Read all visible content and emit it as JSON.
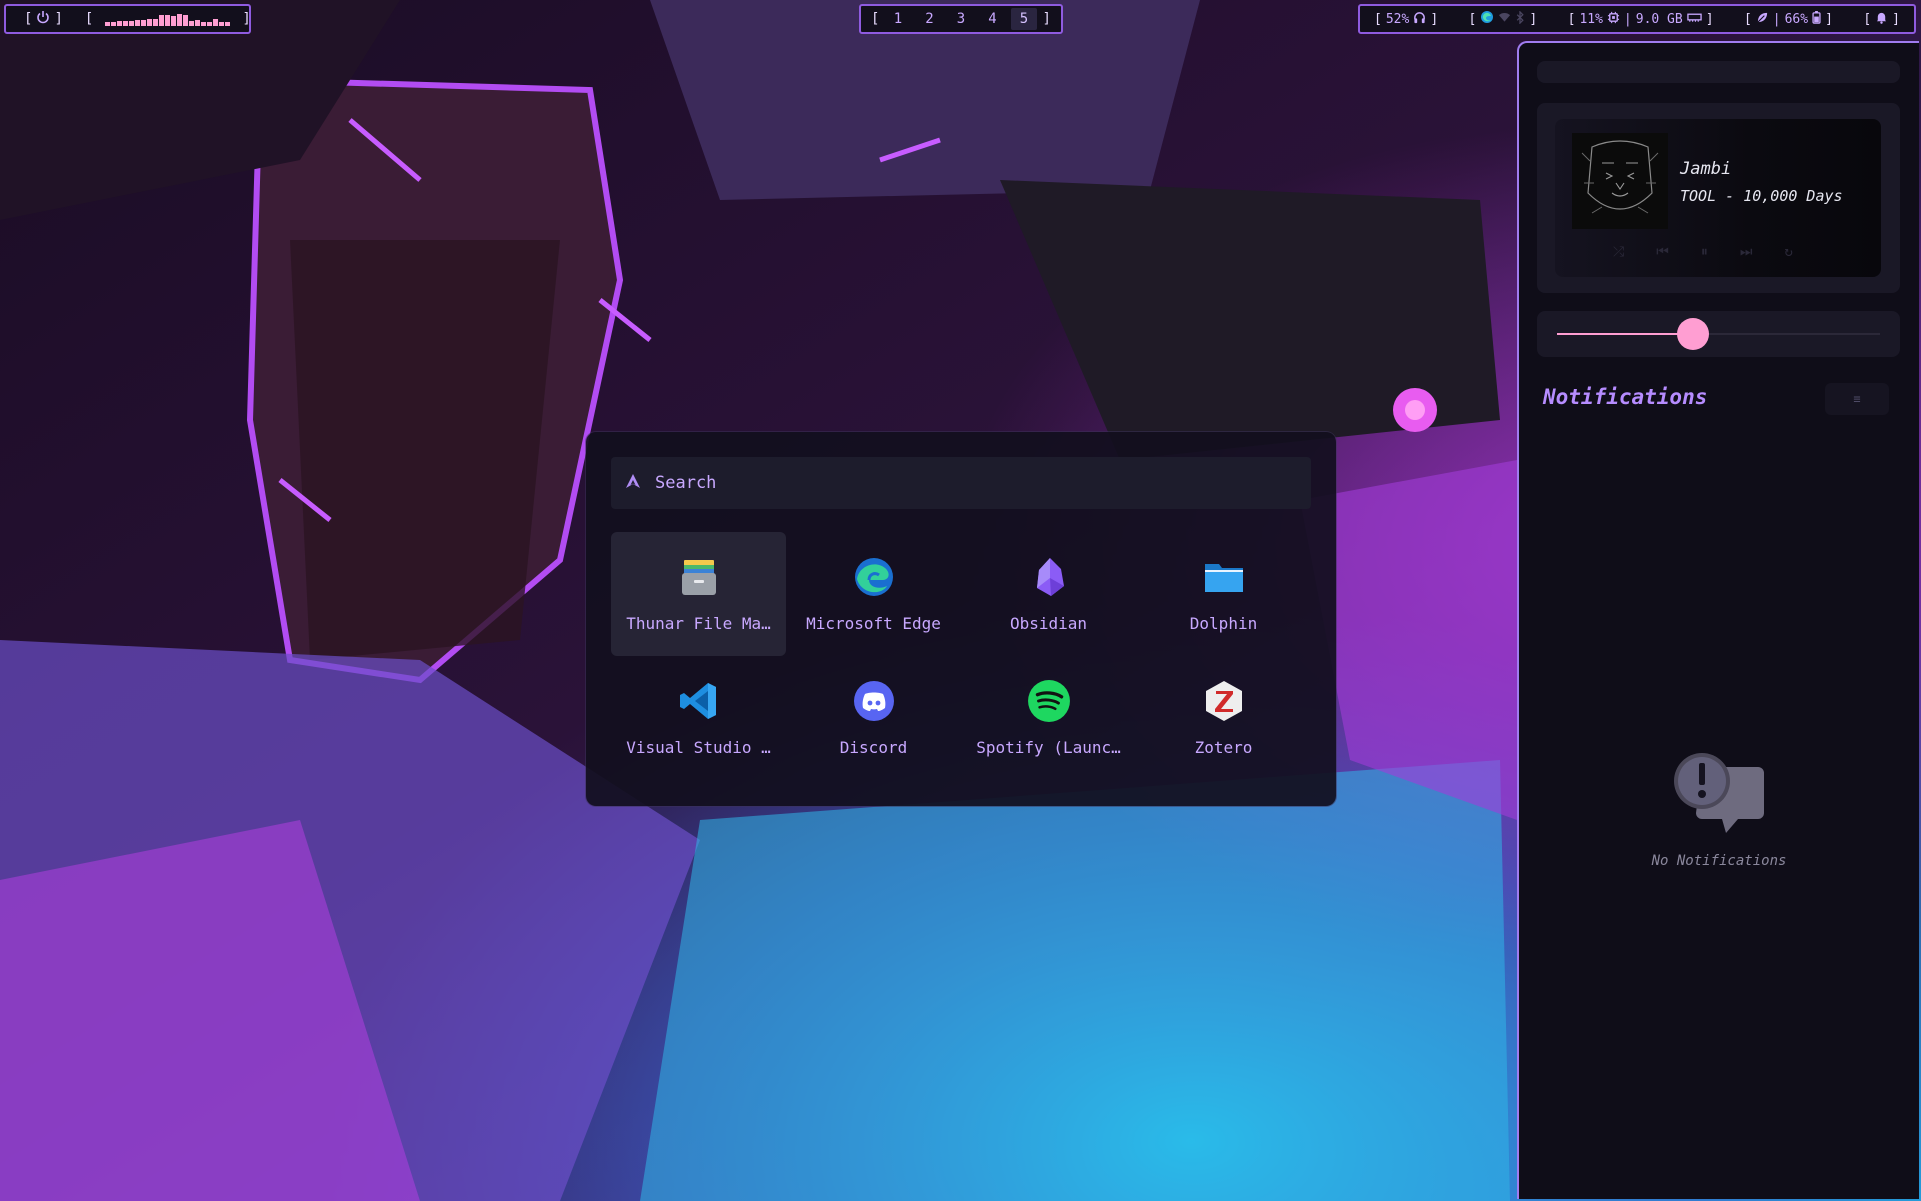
{
  "topbar": {
    "left": {
      "power_icon": "power-icon",
      "bracket_open": "[",
      "bracket_close": "]",
      "cava_levels": [
        0.3,
        0.3,
        0.4,
        0.45,
        0.45,
        0.5,
        0.5,
        0.55,
        0.6,
        0.9,
        0.9,
        0.85,
        1.0,
        0.95,
        0.4,
        0.5,
        0.35,
        0.3,
        0.6,
        0.35,
        0.3
      ]
    },
    "workspaces": {
      "bracket_open": "[",
      "bracket_close": "]",
      "items": [
        "1",
        "2",
        "3",
        "4",
        "5"
      ],
      "active": "5"
    },
    "status": {
      "audio": {
        "volume": "52%",
        "icon": "headphones-icon"
      },
      "network": {
        "icons": [
          "edge-icon",
          "wifi-icon",
          "bluetooth-icon"
        ]
      },
      "system": {
        "cpu": "11%",
        "cpu_icon": "cpu-icon",
        "separator": "|",
        "memory": "9.0 GB",
        "memory_icon": "memory-icon"
      },
      "power": {
        "leaf_icon": "leaf-icon",
        "separator": "|",
        "battery": "66%",
        "battery_icon": "battery-icon"
      },
      "notifications": {
        "icon": "bell-icon"
      }
    }
  },
  "launcher": {
    "search_placeholder": "Search",
    "apps": [
      {
        "label": "Thunar File Ma…",
        "icon": "file-cabinet-icon",
        "selected": true
      },
      {
        "label": "Microsoft Edge",
        "icon": "edge-icon",
        "selected": false
      },
      {
        "label": "Obsidian",
        "icon": "obsidian-icon",
        "selected": false
      },
      {
        "label": "Dolphin",
        "icon": "folder-icon",
        "selected": false
      },
      {
        "label": "Visual Studio …",
        "icon": "vscode-icon",
        "selected": false
      },
      {
        "label": "Discord",
        "icon": "discord-icon",
        "selected": false
      },
      {
        "label": "Spotify (Launc…",
        "icon": "spotify-icon",
        "selected": false
      },
      {
        "label": "Zotero",
        "icon": "zotero-icon",
        "selected": false
      }
    ]
  },
  "panel": {
    "media": {
      "title": "Jambi",
      "artist_album": "TOOL - 10,000 Days"
    },
    "brightness_level": 0.42,
    "notifications_title": "Notifications",
    "empty_text": "No Notifications"
  },
  "colors": {
    "accent": "#a07cf0",
    "pink": "#ff9ed2",
    "text": "#c8a8ff"
  }
}
